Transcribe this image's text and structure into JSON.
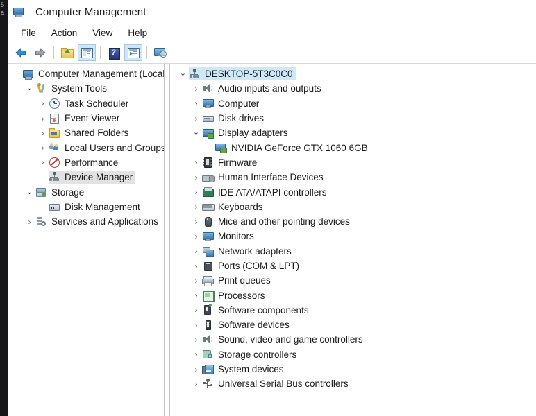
{
  "background_window": {
    "glyph_fragments": [
      "5",
      "a"
    ]
  },
  "window": {
    "title": "Computer Management",
    "title_icon": "computer-management-icon"
  },
  "menubar": {
    "items": [
      {
        "label": "File"
      },
      {
        "label": "Action"
      },
      {
        "label": "View"
      },
      {
        "label": "Help"
      }
    ]
  },
  "toolbar": {
    "buttons": [
      {
        "name": "back-button",
        "icon": "left-arrow-icon",
        "framed": false
      },
      {
        "name": "forward-button",
        "icon": "right-arrow-icon",
        "framed": false
      },
      {
        "name": "up-one-level-button",
        "icon": "folder-up-icon",
        "framed": false
      },
      {
        "name": "show-hide-console-tree-button",
        "icon": "console-tree-icon",
        "framed": true
      },
      {
        "name": "help-button",
        "icon": "help-question-icon",
        "framed": false
      },
      {
        "name": "show-action-pane-button",
        "icon": "action-pane-icon",
        "framed": true
      },
      {
        "name": "properties-button",
        "icon": "monitor-search-icon",
        "framed": false
      }
    ]
  },
  "console_tree": {
    "root": {
      "label": "Computer Management (Local",
      "icon": "computer-management-icon",
      "indent": 0,
      "twisty": "none",
      "selected": false
    },
    "items": [
      {
        "label": "System Tools",
        "icon": "tools-icon",
        "indent": 1,
        "twisty": "expanded",
        "selected": false
      },
      {
        "label": "Task Scheduler",
        "icon": "clock-icon",
        "indent": 2,
        "twisty": "collapsed",
        "selected": false
      },
      {
        "label": "Event Viewer",
        "icon": "event-viewer-icon",
        "indent": 2,
        "twisty": "collapsed",
        "selected": false
      },
      {
        "label": "Shared Folders",
        "icon": "shared-folder-icon",
        "indent": 2,
        "twisty": "collapsed",
        "selected": false
      },
      {
        "label": "Local Users and Groups",
        "icon": "users-icon",
        "indent": 2,
        "twisty": "collapsed",
        "selected": false
      },
      {
        "label": "Performance",
        "icon": "performance-icon",
        "indent": 2,
        "twisty": "collapsed",
        "selected": false
      },
      {
        "label": "Device Manager",
        "icon": "device-manager-icon",
        "indent": 2,
        "twisty": "none",
        "selected": "gray"
      },
      {
        "label": "Storage",
        "icon": "storage-icon",
        "indent": 1,
        "twisty": "expanded",
        "selected": false
      },
      {
        "label": "Disk Management",
        "icon": "disk-management-icon",
        "indent": 2,
        "twisty": "none",
        "selected": false
      },
      {
        "label": "Services and Applications",
        "icon": "services-icon",
        "indent": 1,
        "twisty": "collapsed",
        "selected": false
      }
    ]
  },
  "device_tree": {
    "root": {
      "label": "DESKTOP-5T3C0C0",
      "icon": "device-manager-icon",
      "indent": 0,
      "twisty": "expanded",
      "selected": "blue"
    },
    "items": [
      {
        "label": "Audio inputs and outputs",
        "icon": "speaker-icon",
        "indent": 1,
        "twisty": "collapsed",
        "selected": false
      },
      {
        "label": "Computer",
        "icon": "monitor-icon",
        "indent": 1,
        "twisty": "collapsed",
        "selected": false
      },
      {
        "label": "Disk drives",
        "icon": "hard-disk-icon",
        "indent": 1,
        "twisty": "collapsed",
        "selected": false
      },
      {
        "label": "Display adapters",
        "icon": "display-adapter-icon",
        "indent": 1,
        "twisty": "expanded",
        "selected": false
      },
      {
        "label": "NVIDIA GeForce GTX 1060 6GB",
        "icon": "gpu-icon",
        "indent": 2,
        "twisty": "none",
        "selected": false
      },
      {
        "label": "Firmware",
        "icon": "firmware-chip-icon",
        "indent": 1,
        "twisty": "collapsed",
        "selected": false
      },
      {
        "label": "Human Interface Devices",
        "icon": "hid-icon",
        "indent": 1,
        "twisty": "collapsed",
        "selected": false
      },
      {
        "label": "IDE ATA/ATAPI controllers",
        "icon": "ide-controller-icon",
        "indent": 1,
        "twisty": "collapsed",
        "selected": false
      },
      {
        "label": "Keyboards",
        "icon": "keyboard-icon",
        "indent": 1,
        "twisty": "collapsed",
        "selected": false
      },
      {
        "label": "Mice and other pointing devices",
        "icon": "mouse-icon",
        "indent": 1,
        "twisty": "collapsed",
        "selected": false
      },
      {
        "label": "Monitors",
        "icon": "monitor-icon",
        "indent": 1,
        "twisty": "collapsed",
        "selected": false
      },
      {
        "label": "Network adapters",
        "icon": "network-adapter-icon",
        "indent": 1,
        "twisty": "collapsed",
        "selected": false
      },
      {
        "label": "Ports (COM & LPT)",
        "icon": "port-icon",
        "indent": 1,
        "twisty": "collapsed",
        "selected": false
      },
      {
        "label": "Print queues",
        "icon": "printer-icon",
        "indent": 1,
        "twisty": "collapsed",
        "selected": false
      },
      {
        "label": "Processors",
        "icon": "processor-icon",
        "indent": 1,
        "twisty": "collapsed",
        "selected": false
      },
      {
        "label": "Software components",
        "icon": "software-component-icon",
        "indent": 1,
        "twisty": "collapsed",
        "selected": false
      },
      {
        "label": "Software devices",
        "icon": "software-device-icon",
        "indent": 1,
        "twisty": "collapsed",
        "selected": false
      },
      {
        "label": "Sound, video and game controllers",
        "icon": "speaker-icon",
        "indent": 1,
        "twisty": "collapsed",
        "selected": false
      },
      {
        "label": "Storage controllers",
        "icon": "storage-controller-icon",
        "indent": 1,
        "twisty": "collapsed",
        "selected": false
      },
      {
        "label": "System devices",
        "icon": "system-device-icon",
        "indent": 1,
        "twisty": "collapsed",
        "selected": false
      },
      {
        "label": "Universal Serial Bus controllers",
        "icon": "usb-icon",
        "indent": 1,
        "twisty": "collapsed",
        "selected": false
      }
    ]
  },
  "glyphs": {
    "collapsed": "›",
    "expanded": "⌄"
  },
  "colors": {
    "selection_blue": "#cde8f7",
    "selection_gray": "#e2e2e2",
    "toolbar_active": "#cfe6f7",
    "text": "#1a1a1a",
    "window_bg": "#ffffff",
    "divider": "#c4c4c4"
  }
}
